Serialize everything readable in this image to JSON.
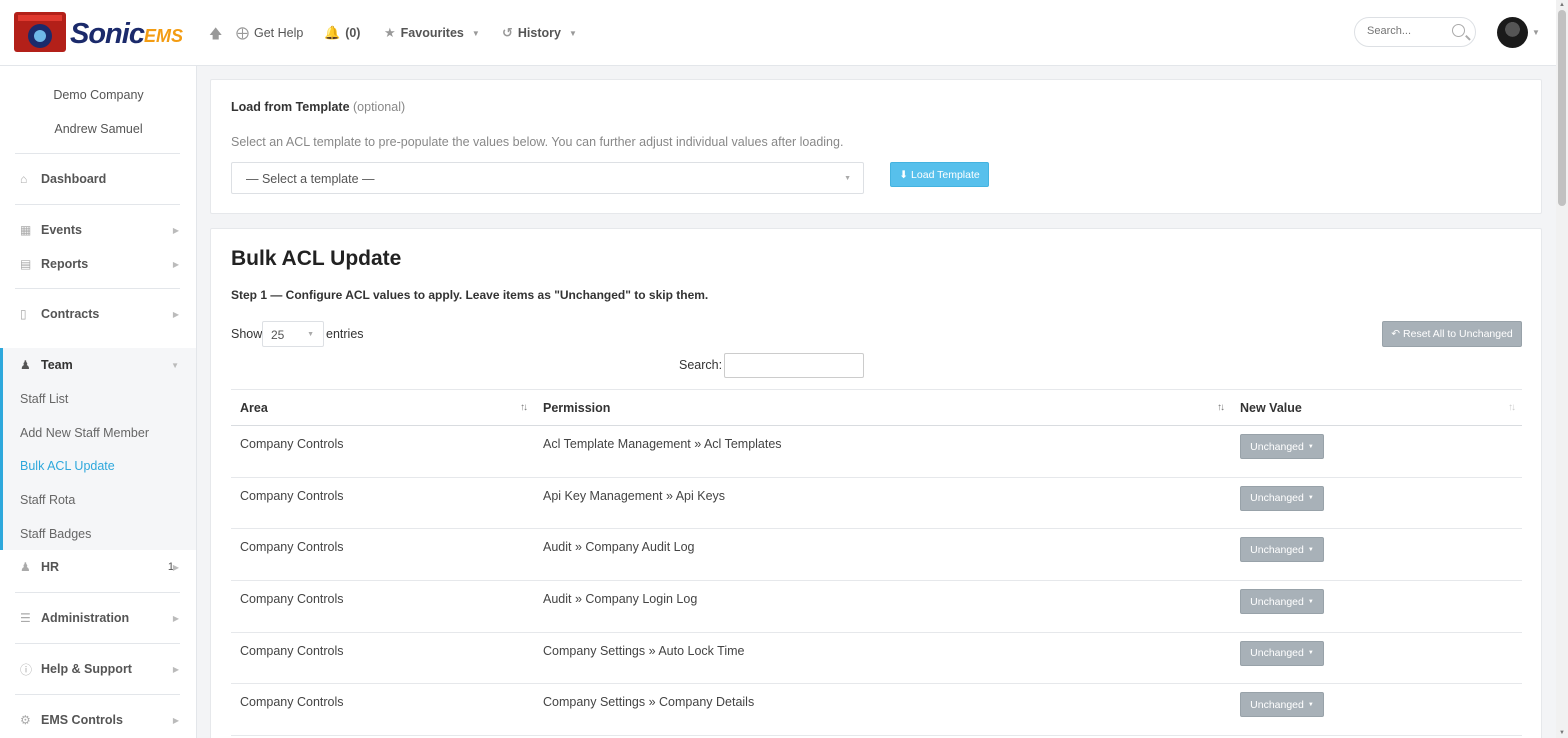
{
  "brand": {
    "name": "Sonic",
    "suffix": "EMS"
  },
  "topnav": {
    "get_help": "Get Help",
    "notifications": "(0)",
    "favourites": "Favourites",
    "history": "History",
    "search_placeholder": "Search..."
  },
  "sidebar": {
    "company": "Demo Company",
    "user": "Andrew Samuel",
    "items": {
      "dashboard": "Dashboard",
      "events": "Events",
      "reports": "Reports",
      "contracts": "Contracts",
      "team": "Team",
      "hr": "HR",
      "hr_badge": "1",
      "administration": "Administration",
      "help": "Help & Support",
      "ems_controls": "EMS Controls"
    },
    "team_sub": {
      "staff_list": "Staff List",
      "add_staff": "Add New Staff Member",
      "bulk_acl": "Bulk ACL Update",
      "staff_rota": "Staff Rota",
      "staff_badges": "Staff Badges"
    }
  },
  "template_panel": {
    "title": "Load from Template",
    "optional": "(optional)",
    "description": "Select an ACL template to pre-populate the values below. You can further adjust individual values after loading.",
    "select_placeholder": "— Select a template —",
    "load_button": "Load Template"
  },
  "bulk_panel": {
    "title": "Bulk ACL Update",
    "step": "Step 1 — Configure ACL values to apply. Leave items as \"Unchanged\" to skip them.",
    "show": "Show",
    "entries_value": "25",
    "entries": "entries",
    "reset_button": "Reset All to Unchanged",
    "search_label": "Search:"
  },
  "table": {
    "headers": {
      "area": "Area",
      "permission": "Permission",
      "new_value": "New Value"
    },
    "rows": [
      {
        "area": "Company Controls",
        "permission": "Acl Template Management » Acl Templates",
        "value": "Unchanged"
      },
      {
        "area": "Company Controls",
        "permission": "Api Key Management » Api Keys",
        "value": "Unchanged"
      },
      {
        "area": "Company Controls",
        "permission": "Audit » Company Audit Log",
        "value": "Unchanged"
      },
      {
        "area": "Company Controls",
        "permission": "Audit » Company Login Log",
        "value": "Unchanged"
      },
      {
        "area": "Company Controls",
        "permission": "Company Settings » Auto Lock Time",
        "value": "Unchanged"
      },
      {
        "area": "Company Controls",
        "permission": "Company Settings » Company Details",
        "value": "Unchanged"
      }
    ]
  }
}
